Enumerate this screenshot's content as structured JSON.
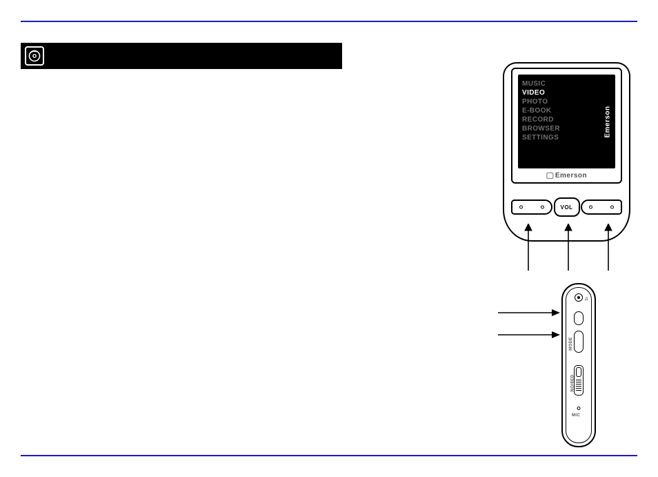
{
  "section": {
    "title": ""
  },
  "device": {
    "brand": "Emerson",
    "side_logo": "Emerson",
    "buttons": {
      "vol": "VOL"
    },
    "menu": {
      "items": [
        "MUSIC",
        "VIDEO",
        "PHOTO",
        "E-BOOK",
        "RECORD",
        "BROWSER",
        "SETTINGS"
      ],
      "selected_index": 1
    },
    "side_labels": {
      "mode": "MODE",
      "switch": "NO/6ED",
      "mic": "MIC"
    }
  }
}
